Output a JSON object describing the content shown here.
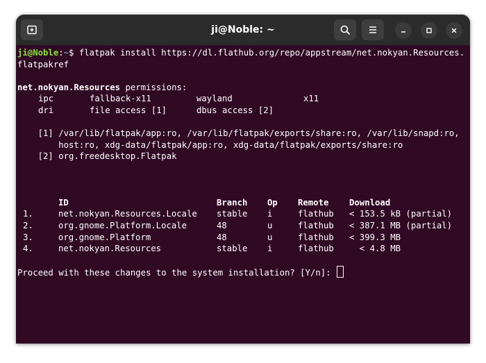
{
  "window": {
    "title": "ji@Noble: ~"
  },
  "terminal": {
    "prompt_user": "ji@Noble",
    "prompt_sep": ":",
    "prompt_path": "~",
    "prompt_dollar": "$",
    "command_line1": " flatpak install https://dl.flathub.org/repo/appstream/net.nokyan.Resources.",
    "command_line2": "flatpakref",
    "app_id": "net.nokyan.Resources",
    "permissions_label": " permissions:",
    "perm_rows": [
      [
        "ipc",
        "fallback-x11",
        "wayland",
        "x11"
      ],
      [
        "dri",
        "file access [1]",
        "dbus access [2]",
        ""
      ]
    ],
    "note1_line1": "    [1] /var/lib/flatpak/app:ro, /var/lib/flatpak/exports/share:ro, /var/lib/snapd:ro,",
    "note1_line2": "        host:ro, xdg-data/flatpak/app:ro, xdg-data/flatpak/exports/share:ro",
    "note2": "    [2] org.freedesktop.Flatpak",
    "table_headers": [
      "ID",
      "Branch",
      "Op",
      "Remote",
      "Download"
    ],
    "table_rows": [
      [
        "1.",
        "net.nokyan.Resources.Locale",
        "stable",
        "i",
        "flathub",
        "< 153.5 kB (partial)"
      ],
      [
        "2.",
        "org.gnome.Platform.Locale",
        "48",
        "u",
        "flathub",
        "< 387.1 MB (partial)"
      ],
      [
        "3.",
        "org.gnome.Platform",
        "48",
        "u",
        "flathub",
        "< 399.3 MB"
      ],
      [
        "4.",
        "net.nokyan.Resources",
        "stable",
        "i",
        "flathub",
        "  < 4.8 MB"
      ]
    ],
    "question": "Proceed with these changes to the system installation? [Y/n]: "
  },
  "colors": {
    "terminal_bg": "#300a24",
    "titlebar_bg": "#2b2b2b",
    "prompt_user": "#8ae234",
    "prompt_path": "#729fcf"
  },
  "icons": {
    "new_tab": "new-tab-icon",
    "search": "search-icon",
    "menu": "hamburger-menu-icon",
    "minimize": "minimize-icon",
    "maximize": "maximize-icon",
    "close": "close-icon"
  }
}
